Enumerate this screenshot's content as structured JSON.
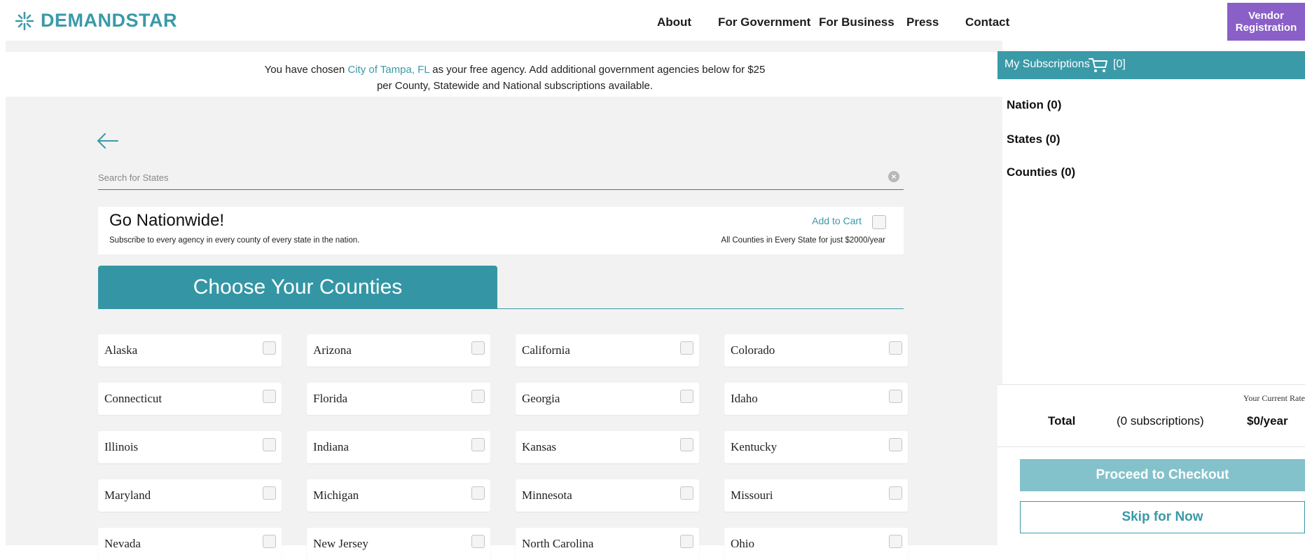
{
  "brand": {
    "name": "DEMANDSTAR",
    "color": "#3a9aa8"
  },
  "nav": {
    "items": [
      "About",
      "For Government",
      "For Business",
      "Press",
      "Contact"
    ],
    "vendor_line1": "Vendor",
    "vendor_line2": "Registration",
    "vendor_color": "#8a5fc7"
  },
  "notice": {
    "prefix": "You have chosen ",
    "agency": "City of Tampa, FL",
    "suffix": " as your free agency. Add additional government agencies below for $25",
    "line2": "per County, Statewide and National subscriptions available."
  },
  "search": {
    "placeholder": "Search for States",
    "back_icon": "arrow-left-icon",
    "clear_icon": "close-circle-icon"
  },
  "nationwide": {
    "title": "Go Nationwide!",
    "description": "Subscribe to every agency in every county of every state in the nation.",
    "add_label": "Add to Cart",
    "price_text": "All Counties in Every State for just $2000/year"
  },
  "tab": {
    "label": "Choose Your Counties"
  },
  "states": [
    "Alaska",
    "Arizona",
    "California",
    "Colorado",
    "Connecticut",
    "Florida",
    "Georgia",
    "Idaho",
    "Illinois",
    "Indiana",
    "Kansas",
    "Kentucky",
    "Maryland",
    "Michigan",
    "Minnesota",
    "Missouri",
    "Nevada",
    "New Jersey",
    "North Carolina",
    "Ohio"
  ],
  "subscriptions": {
    "title": "My Subscriptions",
    "cart_icon": "cart-icon",
    "cart_count": "[0]",
    "nation": "Nation (0)",
    "states": "States (0)",
    "counties": "Counties (0)"
  },
  "totals": {
    "rate_label": "Your Current Rate",
    "total_label": "Total",
    "count_text": "(0 subscriptions)",
    "amount": "$0/year",
    "checkout_label": "Proceed to Checkout",
    "skip_label": "Skip for Now"
  }
}
